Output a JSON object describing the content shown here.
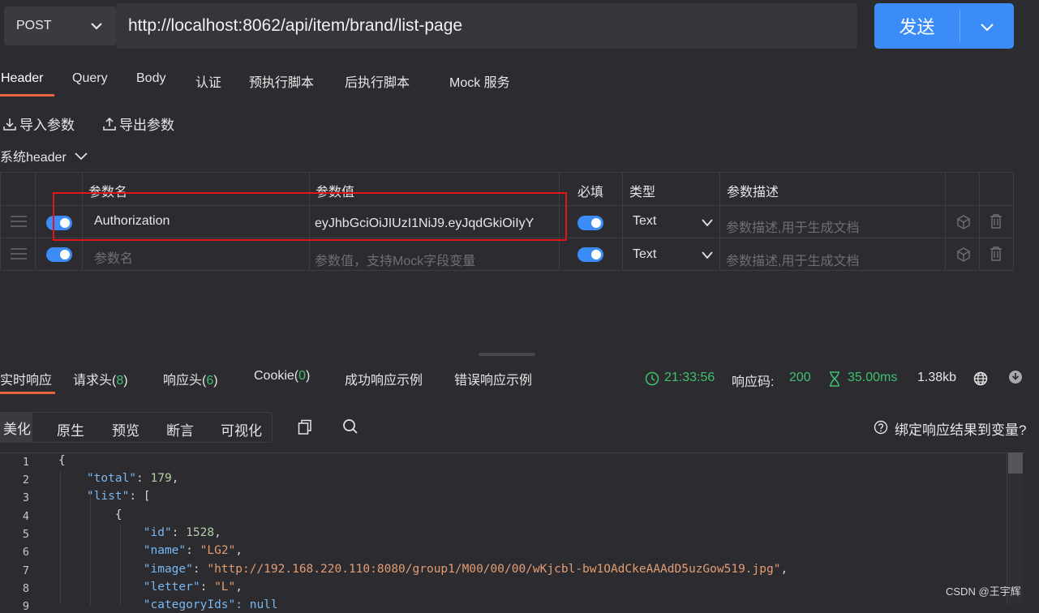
{
  "request": {
    "method": "POST",
    "url": "http://localhost:8062/api/item/brand/list-page",
    "send_label": "发送"
  },
  "req_tabs": [
    "Header",
    "Query",
    "Body",
    "认证",
    "预执行脚本",
    "后执行脚本",
    "Mock 服务"
  ],
  "toolbar": {
    "import_label": "导入参数",
    "export_label": "导出参数"
  },
  "system_header_label": "系统header",
  "param_table": {
    "headers": [
      "参数名",
      "参数值",
      "必填",
      "类型",
      "参数描述"
    ],
    "rows": [
      {
        "name": "Authorization",
        "value": "eyJhbGciOiJIUzI1NiJ9.eyJqdGkiOiIyY",
        "type": "Text",
        "desc_placeholder": "参数描述,用于生成文档"
      },
      {
        "name_placeholder": "参数名",
        "value_placeholder": "参数值，支持Mock字段变量",
        "type": "Text",
        "desc_placeholder": "参数描述,用于生成文档"
      }
    ]
  },
  "resp_tabs": {
    "realtime": "实时响应",
    "req_headers": "请求头(",
    "req_headers_count": "8",
    "req_headers_close": ")",
    "resp_headers": "响应头(",
    "resp_headers_count": "6",
    "resp_headers_close": ")",
    "cookie": "Cookie(",
    "cookie_count": "0",
    "cookie_close": ")",
    "success_example": "成功响应示例",
    "error_example": "错误响应示例"
  },
  "resp_meta": {
    "time": "21:33:56",
    "status_label": "响应码:",
    "status_code": "200",
    "duration": "35.00ms",
    "size": "1.38kb"
  },
  "view_tabs": [
    "美化",
    "原生",
    "预览",
    "断言",
    "可视化"
  ],
  "bind_var_label": "绑定响应结果到变量?",
  "code": {
    "line_numbers": [
      "1",
      "2",
      "3",
      "4",
      "5",
      "6",
      "7",
      "8",
      "9"
    ],
    "total_key": "\"total\"",
    "total_val": "179",
    "list_key": "\"list\"",
    "id_key": "\"id\"",
    "id_val": "1528",
    "name_key": "\"name\"",
    "name_val": "\"LG2\"",
    "image_key": "\"image\"",
    "image_val": "\"http://192.168.220.110:8080/group1/M00/00/00/wKjcbl-bw1OAdCkeAAAdD5uzGow519.jpg\"",
    "letter_key": "\"letter\"",
    "letter_val": "\"L\"",
    "partial": "\"categoryIds\": null"
  },
  "watermark": "CSDN @王宇辉",
  "colors": {
    "accent": "#3b8cf6",
    "tab_underline": "#e8663c",
    "success": "#3ec270",
    "highlight_box": "#e0141b"
  }
}
